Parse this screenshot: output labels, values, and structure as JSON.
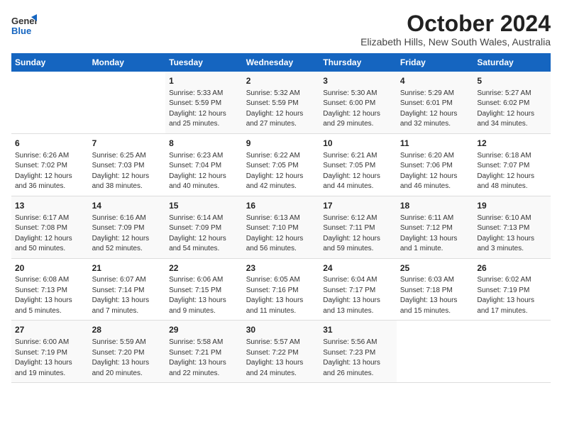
{
  "logo": {
    "line1": "General",
    "line2": "Blue"
  },
  "title": "October 2024",
  "subtitle": "Elizabeth Hills, New South Wales, Australia",
  "days_of_week": [
    "Sunday",
    "Monday",
    "Tuesday",
    "Wednesday",
    "Thursday",
    "Friday",
    "Saturday"
  ],
  "weeks": [
    [
      {
        "day": "",
        "info": ""
      },
      {
        "day": "",
        "info": ""
      },
      {
        "day": "1",
        "info": "Sunrise: 5:33 AM\nSunset: 5:59 PM\nDaylight: 12 hours\nand 25 minutes."
      },
      {
        "day": "2",
        "info": "Sunrise: 5:32 AM\nSunset: 5:59 PM\nDaylight: 12 hours\nand 27 minutes."
      },
      {
        "day": "3",
        "info": "Sunrise: 5:30 AM\nSunset: 6:00 PM\nDaylight: 12 hours\nand 29 minutes."
      },
      {
        "day": "4",
        "info": "Sunrise: 5:29 AM\nSunset: 6:01 PM\nDaylight: 12 hours\nand 32 minutes."
      },
      {
        "day": "5",
        "info": "Sunrise: 5:27 AM\nSunset: 6:02 PM\nDaylight: 12 hours\nand 34 minutes."
      }
    ],
    [
      {
        "day": "6",
        "info": "Sunrise: 6:26 AM\nSunset: 7:02 PM\nDaylight: 12 hours\nand 36 minutes."
      },
      {
        "day": "7",
        "info": "Sunrise: 6:25 AM\nSunset: 7:03 PM\nDaylight: 12 hours\nand 38 minutes."
      },
      {
        "day": "8",
        "info": "Sunrise: 6:23 AM\nSunset: 7:04 PM\nDaylight: 12 hours\nand 40 minutes."
      },
      {
        "day": "9",
        "info": "Sunrise: 6:22 AM\nSunset: 7:05 PM\nDaylight: 12 hours\nand 42 minutes."
      },
      {
        "day": "10",
        "info": "Sunrise: 6:21 AM\nSunset: 7:05 PM\nDaylight: 12 hours\nand 44 minutes."
      },
      {
        "day": "11",
        "info": "Sunrise: 6:20 AM\nSunset: 7:06 PM\nDaylight: 12 hours\nand 46 minutes."
      },
      {
        "day": "12",
        "info": "Sunrise: 6:18 AM\nSunset: 7:07 PM\nDaylight: 12 hours\nand 48 minutes."
      }
    ],
    [
      {
        "day": "13",
        "info": "Sunrise: 6:17 AM\nSunset: 7:08 PM\nDaylight: 12 hours\nand 50 minutes."
      },
      {
        "day": "14",
        "info": "Sunrise: 6:16 AM\nSunset: 7:09 PM\nDaylight: 12 hours\nand 52 minutes."
      },
      {
        "day": "15",
        "info": "Sunrise: 6:14 AM\nSunset: 7:09 PM\nDaylight: 12 hours\nand 54 minutes."
      },
      {
        "day": "16",
        "info": "Sunrise: 6:13 AM\nSunset: 7:10 PM\nDaylight: 12 hours\nand 56 minutes."
      },
      {
        "day": "17",
        "info": "Sunrise: 6:12 AM\nSunset: 7:11 PM\nDaylight: 12 hours\nand 59 minutes."
      },
      {
        "day": "18",
        "info": "Sunrise: 6:11 AM\nSunset: 7:12 PM\nDaylight: 13 hours\nand 1 minute."
      },
      {
        "day": "19",
        "info": "Sunrise: 6:10 AM\nSunset: 7:13 PM\nDaylight: 13 hours\nand 3 minutes."
      }
    ],
    [
      {
        "day": "20",
        "info": "Sunrise: 6:08 AM\nSunset: 7:13 PM\nDaylight: 13 hours\nand 5 minutes."
      },
      {
        "day": "21",
        "info": "Sunrise: 6:07 AM\nSunset: 7:14 PM\nDaylight: 13 hours\nand 7 minutes."
      },
      {
        "day": "22",
        "info": "Sunrise: 6:06 AM\nSunset: 7:15 PM\nDaylight: 13 hours\nand 9 minutes."
      },
      {
        "day": "23",
        "info": "Sunrise: 6:05 AM\nSunset: 7:16 PM\nDaylight: 13 hours\nand 11 minutes."
      },
      {
        "day": "24",
        "info": "Sunrise: 6:04 AM\nSunset: 7:17 PM\nDaylight: 13 hours\nand 13 minutes."
      },
      {
        "day": "25",
        "info": "Sunrise: 6:03 AM\nSunset: 7:18 PM\nDaylight: 13 hours\nand 15 minutes."
      },
      {
        "day": "26",
        "info": "Sunrise: 6:02 AM\nSunset: 7:19 PM\nDaylight: 13 hours\nand 17 minutes."
      }
    ],
    [
      {
        "day": "27",
        "info": "Sunrise: 6:00 AM\nSunset: 7:19 PM\nDaylight: 13 hours\nand 19 minutes."
      },
      {
        "day": "28",
        "info": "Sunrise: 5:59 AM\nSunset: 7:20 PM\nDaylight: 13 hours\nand 20 minutes."
      },
      {
        "day": "29",
        "info": "Sunrise: 5:58 AM\nSunset: 7:21 PM\nDaylight: 13 hours\nand 22 minutes."
      },
      {
        "day": "30",
        "info": "Sunrise: 5:57 AM\nSunset: 7:22 PM\nDaylight: 13 hours\nand 24 minutes."
      },
      {
        "day": "31",
        "info": "Sunrise: 5:56 AM\nSunset: 7:23 PM\nDaylight: 13 hours\nand 26 minutes."
      },
      {
        "day": "",
        "info": ""
      },
      {
        "day": "",
        "info": ""
      }
    ]
  ]
}
